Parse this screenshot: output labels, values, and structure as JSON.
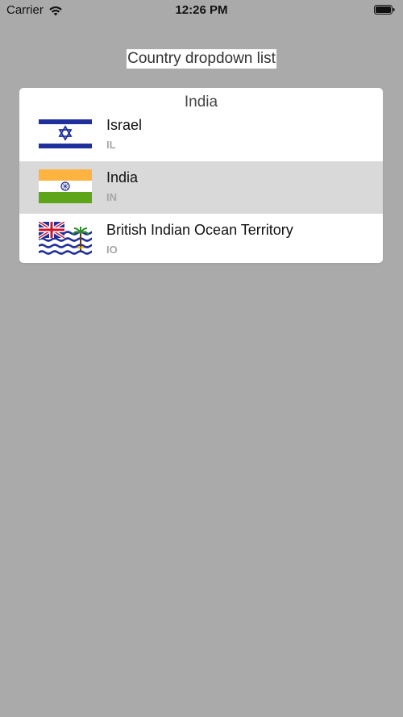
{
  "status_bar": {
    "carrier": "Carrier",
    "time": "12:26 PM",
    "icons": [
      "wifi-icon",
      "battery-icon"
    ]
  },
  "title": "Country dropdown list",
  "dropdown": {
    "selected_value": "India",
    "items": [
      {
        "name": "Israel",
        "code": "IL",
        "flag": "israel-flag-icon",
        "selected": false
      },
      {
        "name": "India",
        "code": "IN",
        "flag": "india-flag-icon",
        "selected": true
      },
      {
        "name": "British Indian Ocean Territory",
        "code": "IO",
        "flag": "british-indian-ocean-territory-flag-icon",
        "selected": false
      }
    ]
  },
  "colors": {
    "background": "#aaaaaa",
    "selected_row": "#d9d9d9",
    "code_text": "#a6a6a6",
    "israel_blue": "#1f2f9c",
    "india_saffron": "#ffb340",
    "india_green": "#5fa51a"
  }
}
